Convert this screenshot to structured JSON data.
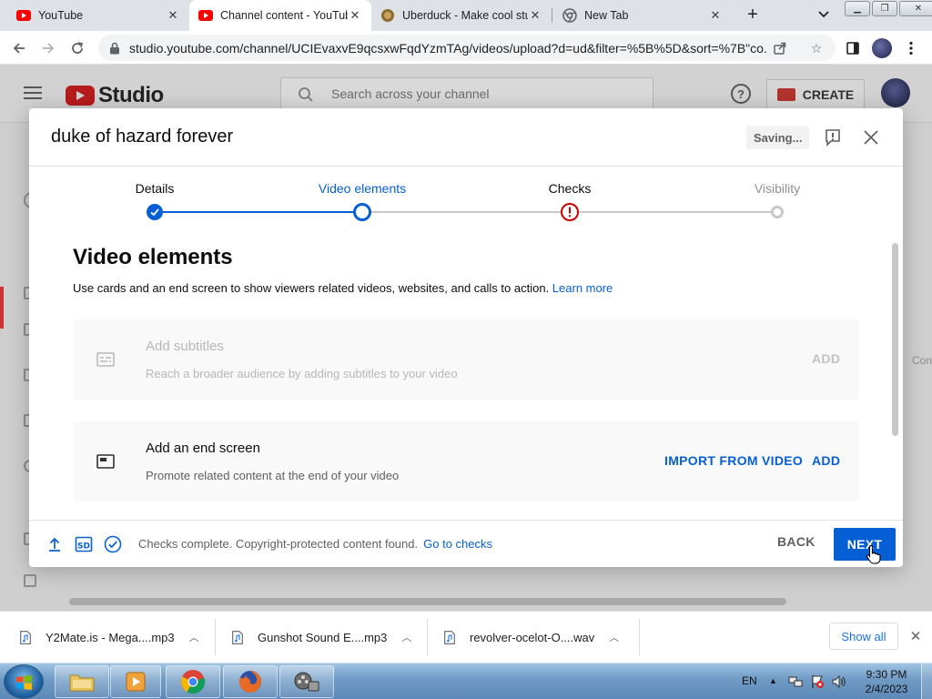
{
  "browser": {
    "tabs": [
      {
        "title": "YouTube",
        "icon": "youtube-favicon",
        "active": false
      },
      {
        "title": "Channel content - YouTube Studio",
        "icon": "youtube-favicon",
        "active": true
      },
      {
        "title": "Uberduck - Make cool stuff",
        "icon": "uberduck-favicon",
        "active": false
      },
      {
        "title": "New Tab",
        "icon": "chrome-favicon",
        "active": false
      }
    ],
    "url": "studio.youtube.com/channel/UCIEvaxvE9qcsxwFqdYzmTAg/videos/upload?d=ud&filter=%5B%5D&sort=%7B\"co..."
  },
  "studio": {
    "logo_text": "Studio",
    "search_placeholder": "Search across your channel",
    "create_label": "CREATE",
    "bg_hint": "Con"
  },
  "dialog": {
    "title": "duke of hazard forever",
    "saving_label": "Saving...",
    "steps": [
      {
        "label": "Details",
        "state": "done"
      },
      {
        "label": "Video elements",
        "state": "current"
      },
      {
        "label": "Checks",
        "state": "warning"
      },
      {
        "label": "Visibility",
        "state": "pending"
      }
    ],
    "section_title": "Video elements",
    "section_desc": "Use cards and an end screen to show viewers related videos, websites, and calls to action.",
    "learn_more": "Learn more",
    "cards": [
      {
        "title": "Add subtitles",
        "subtitle": "Reach a broader audience by adding subtitles to your video",
        "action": "ADD",
        "enabled": false
      },
      {
        "title": "Add an end screen",
        "subtitle": "Promote related content at the end of your video",
        "import_action": "IMPORT FROM VIDEO",
        "action": "ADD",
        "enabled": true
      }
    ],
    "footer": {
      "quality_badge": "SD",
      "status": "Checks complete. Copyright-protected content found.",
      "status_link": "Go to checks",
      "back_label": "BACK",
      "next_label": "NEXT"
    }
  },
  "downloads": {
    "items": [
      "Y2Mate.is - Mega....mp3",
      "Gunshot Sound E....mp3",
      "revolver-ocelot-O....wav"
    ],
    "show_all": "Show all"
  },
  "taskbar": {
    "lang": "EN",
    "time": "9:30 PM",
    "date": "2/4/2023"
  },
  "colors": {
    "accent": "#065fd4",
    "warning": "#cc0000",
    "youtube_red": "#ff0000"
  }
}
